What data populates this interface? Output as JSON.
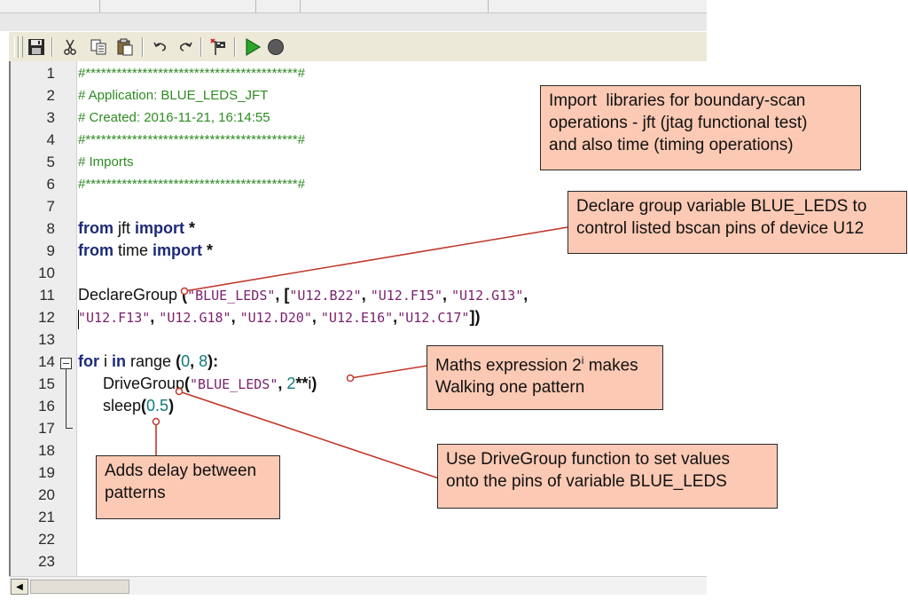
{
  "editor": {
    "line_numbers": [
      "1",
      "2",
      "3",
      "4",
      "5",
      "6",
      "7",
      "8",
      "9",
      "10",
      "11",
      "12",
      "13",
      "14",
      "15",
      "16",
      "17",
      "18",
      "19",
      "20",
      "21",
      "22",
      "23"
    ],
    "line1": "#*****************************************#",
    "line2": "# Application: BLUE_LEDS_JFT",
    "line3": "# Created: 2016-11-21, 16:14:55",
    "line4": "#*****************************************#",
    "line5": "# Imports",
    "line6": "#*****************************************#",
    "line8": {
      "kw1": "from",
      "mod": " jft ",
      "kw2": "import",
      "star": " *"
    },
    "line9": {
      "kw1": "from",
      "mod": " time ",
      "kw2": "import",
      "star": " *"
    },
    "line11": {
      "fn": "DeclareGroup",
      "open": " (",
      "s1": "\"BLUE_LEDS\"",
      "mid": ", [",
      "s2": "\"U12.B22\"",
      "c1": ", ",
      "s3": "\"U12.F15\"",
      "c2": ", ",
      "s4": "\"U12.G13\"",
      "end": ","
    },
    "line12": {
      "s1": "\"U12.F13\"",
      "c1": ", ",
      "s2": "\"U12.G18\"",
      "c2": ", ",
      "s3": "\"U12.D20\"",
      "c3": ", ",
      "s4": "\"U12.E16\"",
      "c4": ",",
      "s5": "\"U12.C17\"",
      "end": "])"
    },
    "line14": {
      "kw1": "for",
      "v": " i ",
      "kw2": "in",
      "fn": " range ",
      "open": "(",
      "n1": "0",
      "c": ", ",
      "n2": "8",
      "end": "):"
    },
    "line15": {
      "fn": "DriveGroup",
      "open": "(",
      "s1": "\"BLUE_LEDS\"",
      "c": ", ",
      "n": "2",
      "op": "**",
      "v": "i",
      "end": ")"
    },
    "line16": {
      "fn": "sleep",
      "open": "(",
      "n": "0.5",
      "end": ")"
    }
  },
  "annotations": {
    "imports": "Import  libraries for boundary-scan\noperations - jft (jtag functional test)\nand also time (timing operations)",
    "declare": "Declare group variable BLUE_LEDS to\ncontrol listed bscan pins of device U12",
    "maths_a": "Maths expression 2",
    "maths_sup": "i",
    "maths_b": " makes\nWalking one pattern",
    "delay": "Adds delay between\npatterns",
    "drive": "Use DriveGroup function to set values\nonto the pins of variable BLUE_LEDS"
  },
  "colors": {
    "comment": "#2e8b22",
    "keyword": "#1c2a78",
    "string": "#7a1f6e",
    "number": "#0e7a7a",
    "callout_fill": "#fbc9b4",
    "leader_line": "#c0392b",
    "run_icon": "#2aa52a"
  },
  "toolbar_icons": [
    "save-icon",
    "cut-icon",
    "copy-icon",
    "paste-icon",
    "undo-icon",
    "redo-icon",
    "breakpoint-flag-icon",
    "run-icon",
    "stop-icon"
  ]
}
